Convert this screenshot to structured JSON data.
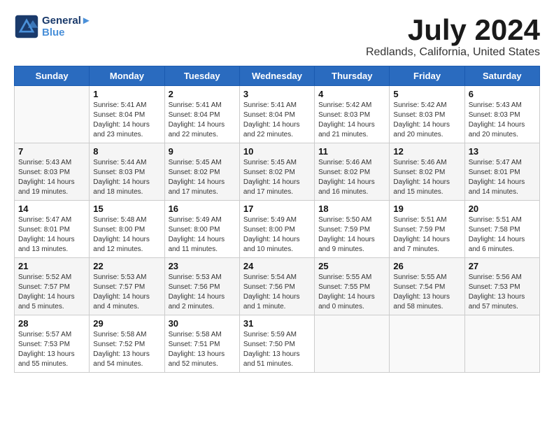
{
  "header": {
    "logo_line1": "General",
    "logo_line2": "Blue",
    "month": "July 2024",
    "location": "Redlands, California, United States"
  },
  "weekdays": [
    "Sunday",
    "Monday",
    "Tuesday",
    "Wednesday",
    "Thursday",
    "Friday",
    "Saturday"
  ],
  "weeks": [
    [
      {
        "day": "",
        "info": ""
      },
      {
        "day": "1",
        "info": "Sunrise: 5:41 AM\nSunset: 8:04 PM\nDaylight: 14 hours\nand 23 minutes."
      },
      {
        "day": "2",
        "info": "Sunrise: 5:41 AM\nSunset: 8:04 PM\nDaylight: 14 hours\nand 22 minutes."
      },
      {
        "day": "3",
        "info": "Sunrise: 5:41 AM\nSunset: 8:04 PM\nDaylight: 14 hours\nand 22 minutes."
      },
      {
        "day": "4",
        "info": "Sunrise: 5:42 AM\nSunset: 8:03 PM\nDaylight: 14 hours\nand 21 minutes."
      },
      {
        "day": "5",
        "info": "Sunrise: 5:42 AM\nSunset: 8:03 PM\nDaylight: 14 hours\nand 20 minutes."
      },
      {
        "day": "6",
        "info": "Sunrise: 5:43 AM\nSunset: 8:03 PM\nDaylight: 14 hours\nand 20 minutes."
      }
    ],
    [
      {
        "day": "7",
        "info": "Sunrise: 5:43 AM\nSunset: 8:03 PM\nDaylight: 14 hours\nand 19 minutes."
      },
      {
        "day": "8",
        "info": "Sunrise: 5:44 AM\nSunset: 8:03 PM\nDaylight: 14 hours\nand 18 minutes."
      },
      {
        "day": "9",
        "info": "Sunrise: 5:45 AM\nSunset: 8:02 PM\nDaylight: 14 hours\nand 17 minutes."
      },
      {
        "day": "10",
        "info": "Sunrise: 5:45 AM\nSunset: 8:02 PM\nDaylight: 14 hours\nand 17 minutes."
      },
      {
        "day": "11",
        "info": "Sunrise: 5:46 AM\nSunset: 8:02 PM\nDaylight: 14 hours\nand 16 minutes."
      },
      {
        "day": "12",
        "info": "Sunrise: 5:46 AM\nSunset: 8:02 PM\nDaylight: 14 hours\nand 15 minutes."
      },
      {
        "day": "13",
        "info": "Sunrise: 5:47 AM\nSunset: 8:01 PM\nDaylight: 14 hours\nand 14 minutes."
      }
    ],
    [
      {
        "day": "14",
        "info": "Sunrise: 5:47 AM\nSunset: 8:01 PM\nDaylight: 14 hours\nand 13 minutes."
      },
      {
        "day": "15",
        "info": "Sunrise: 5:48 AM\nSunset: 8:00 PM\nDaylight: 14 hours\nand 12 minutes."
      },
      {
        "day": "16",
        "info": "Sunrise: 5:49 AM\nSunset: 8:00 PM\nDaylight: 14 hours\nand 11 minutes."
      },
      {
        "day": "17",
        "info": "Sunrise: 5:49 AM\nSunset: 8:00 PM\nDaylight: 14 hours\nand 10 minutes."
      },
      {
        "day": "18",
        "info": "Sunrise: 5:50 AM\nSunset: 7:59 PM\nDaylight: 14 hours\nand 9 minutes."
      },
      {
        "day": "19",
        "info": "Sunrise: 5:51 AM\nSunset: 7:59 PM\nDaylight: 14 hours\nand 7 minutes."
      },
      {
        "day": "20",
        "info": "Sunrise: 5:51 AM\nSunset: 7:58 PM\nDaylight: 14 hours\nand 6 minutes."
      }
    ],
    [
      {
        "day": "21",
        "info": "Sunrise: 5:52 AM\nSunset: 7:57 PM\nDaylight: 14 hours\nand 5 minutes."
      },
      {
        "day": "22",
        "info": "Sunrise: 5:53 AM\nSunset: 7:57 PM\nDaylight: 14 hours\nand 4 minutes."
      },
      {
        "day": "23",
        "info": "Sunrise: 5:53 AM\nSunset: 7:56 PM\nDaylight: 14 hours\nand 2 minutes."
      },
      {
        "day": "24",
        "info": "Sunrise: 5:54 AM\nSunset: 7:56 PM\nDaylight: 14 hours\nand 1 minute."
      },
      {
        "day": "25",
        "info": "Sunrise: 5:55 AM\nSunset: 7:55 PM\nDaylight: 14 hours\nand 0 minutes."
      },
      {
        "day": "26",
        "info": "Sunrise: 5:55 AM\nSunset: 7:54 PM\nDaylight: 13 hours\nand 58 minutes."
      },
      {
        "day": "27",
        "info": "Sunrise: 5:56 AM\nSunset: 7:53 PM\nDaylight: 13 hours\nand 57 minutes."
      }
    ],
    [
      {
        "day": "28",
        "info": "Sunrise: 5:57 AM\nSunset: 7:53 PM\nDaylight: 13 hours\nand 55 minutes."
      },
      {
        "day": "29",
        "info": "Sunrise: 5:58 AM\nSunset: 7:52 PM\nDaylight: 13 hours\nand 54 minutes."
      },
      {
        "day": "30",
        "info": "Sunrise: 5:58 AM\nSunset: 7:51 PM\nDaylight: 13 hours\nand 52 minutes."
      },
      {
        "day": "31",
        "info": "Sunrise: 5:59 AM\nSunset: 7:50 PM\nDaylight: 13 hours\nand 51 minutes."
      },
      {
        "day": "",
        "info": ""
      },
      {
        "day": "",
        "info": ""
      },
      {
        "day": "",
        "info": ""
      }
    ]
  ]
}
